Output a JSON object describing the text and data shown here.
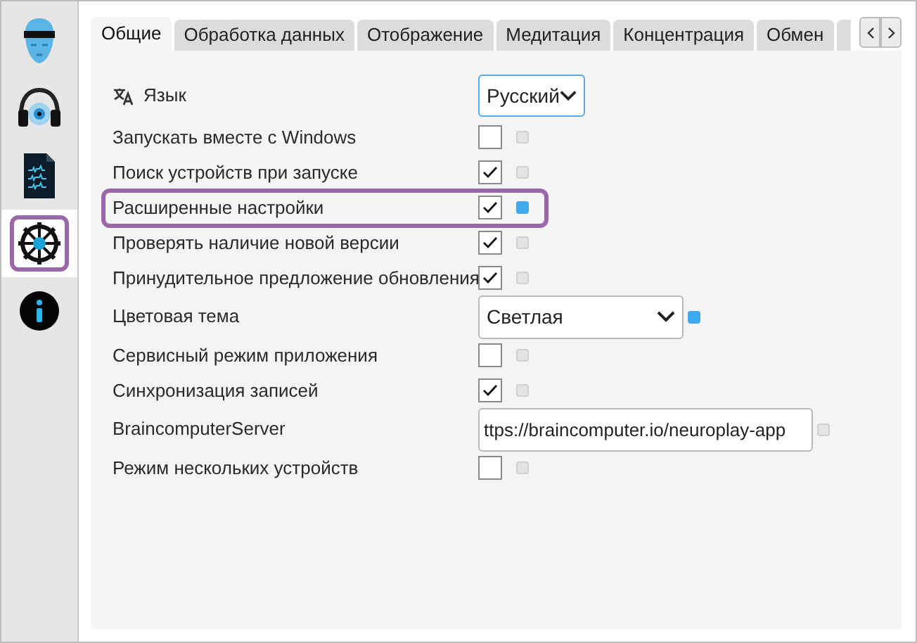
{
  "sidebar": {
    "items": [
      {
        "kind": "face",
        "selected": false
      },
      {
        "kind": "headphones",
        "selected": false
      },
      {
        "kind": "document",
        "selected": false
      },
      {
        "kind": "gear",
        "selected": true
      },
      {
        "kind": "info",
        "selected": false
      }
    ]
  },
  "tabs": [
    {
      "label": "Общие",
      "selected": true
    },
    {
      "label": "Обработка данных",
      "selected": false
    },
    {
      "label": "Отображение",
      "selected": false
    },
    {
      "label": "Медитация",
      "selected": false
    },
    {
      "label": "Концентрация",
      "selected": false
    },
    {
      "label": "Обмен",
      "selected": false
    }
  ],
  "settings": [
    {
      "kind": "select",
      "label": "Язык",
      "value": "Русский",
      "highlighted": false
    },
    {
      "kind": "checkbox",
      "label": "Запускать вместе с Windows",
      "checked": false,
      "indicator": false,
      "highlighted": false
    },
    {
      "kind": "checkbox",
      "label": "Поиск устройств при запуске",
      "checked": true,
      "indicator": false,
      "highlighted": false
    },
    {
      "kind": "checkbox",
      "label": "Расширенные настройки",
      "checked": true,
      "indicator": true,
      "highlighted": true
    },
    {
      "kind": "checkbox",
      "label": "Проверять наличие новой версии",
      "checked": true,
      "indicator": false,
      "highlighted": false
    },
    {
      "kind": "checkbox",
      "label": "Принудительное предложение обновления",
      "checked": true,
      "indicator": false,
      "highlighted": false
    },
    {
      "kind": "select",
      "label": "Цветовая тема",
      "value": "Светлая",
      "indicator": true,
      "highlighted": false
    },
    {
      "kind": "checkbox",
      "label": "Сервисный режим приложения",
      "checked": false,
      "indicator": false,
      "highlighted": false
    },
    {
      "kind": "checkbox",
      "label": "Синхронизация записей",
      "checked": true,
      "indicator": false,
      "highlighted": false
    },
    {
      "kind": "text",
      "label": "BraincomputerServer",
      "value": "ttps://braincomputer.io/neuroplay-app",
      "indicator": false,
      "highlighted": false
    },
    {
      "kind": "checkbox",
      "label": "Режим нескольких устройств",
      "checked": false,
      "indicator": false,
      "highlighted": false
    }
  ]
}
